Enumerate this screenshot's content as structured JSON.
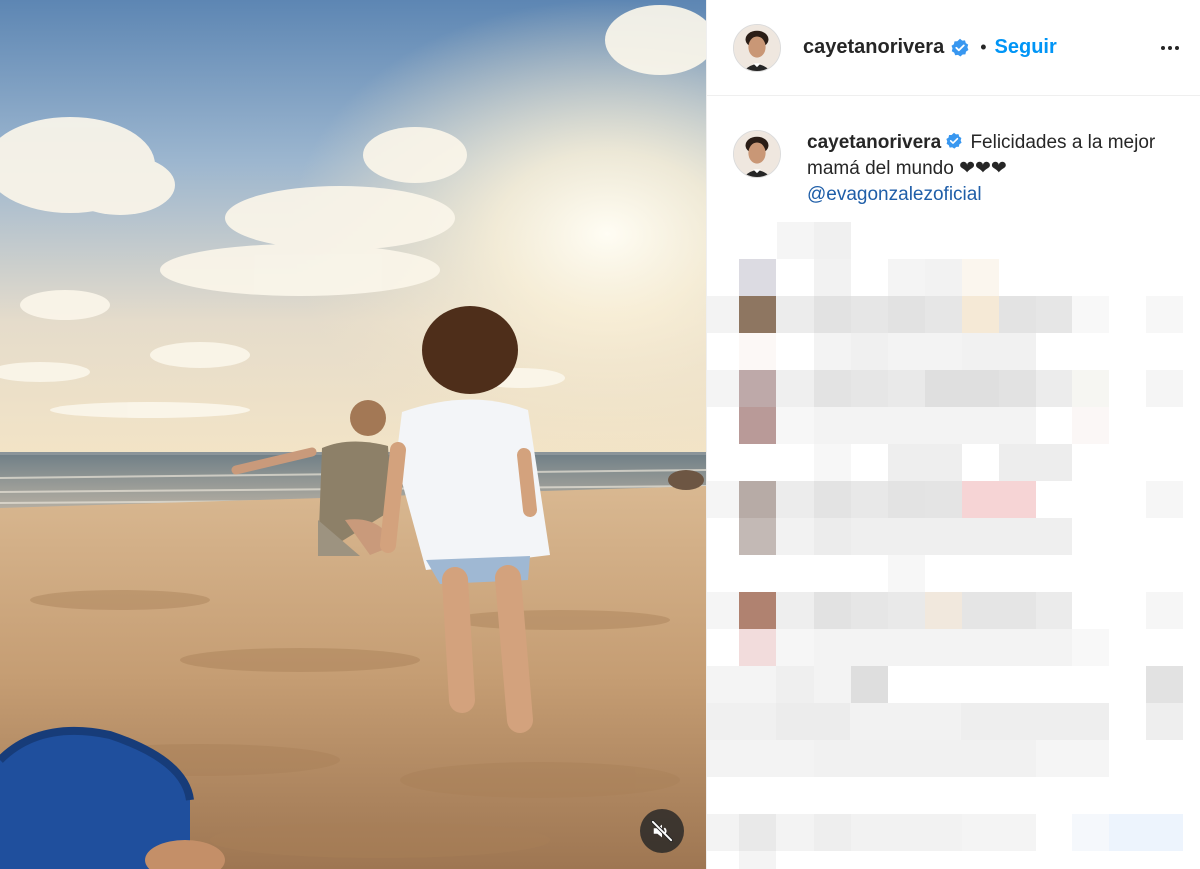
{
  "post": {
    "author": {
      "username": "cayetanorivera",
      "verified": true,
      "avatar": "avatar-icon"
    },
    "header": {
      "separator": "•",
      "follow_label": "Seguir",
      "more_icon": "more-options-icon"
    },
    "caption": {
      "username": "cayetanorivera",
      "text": "Felicidades a la mejor mamá del mundo ❤❤❤",
      "mention": "@evagonzalezoficial"
    },
    "media": {
      "type": "video",
      "description_icon": "beach-video",
      "muted": true,
      "mute_icon": "muted-speaker-icon"
    },
    "comments": {
      "state": "pixelated-blurred"
    },
    "colors": {
      "follow": "#0095f6",
      "mention": "#1f5ea8",
      "verified": "#3897f0",
      "text": "#262626"
    }
  }
}
